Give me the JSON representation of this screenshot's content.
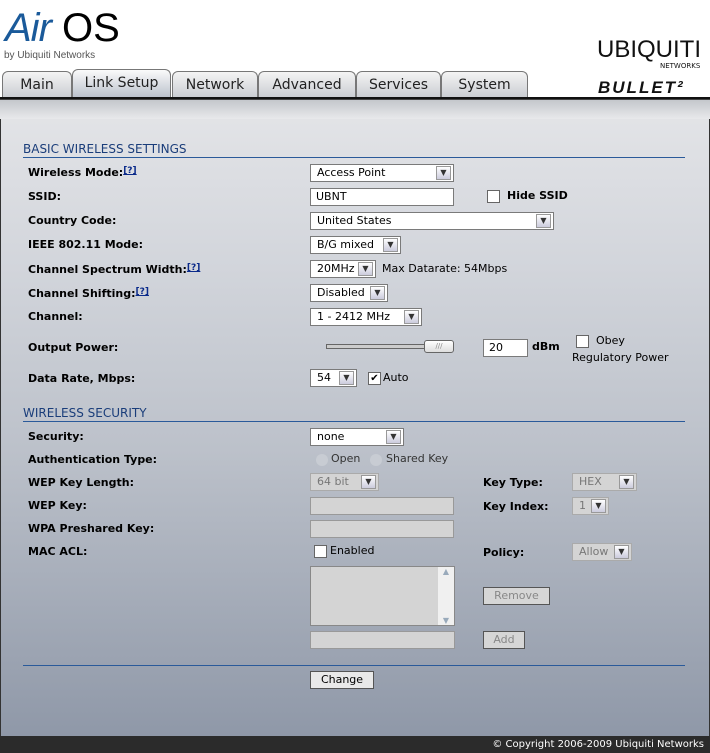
{
  "header": {
    "logo_left": "AirOS",
    "logo_by": "by Ubiquiti Networks",
    "logo_right": "UBIQUITI",
    "logo_right_sub": "NETWORKS",
    "product": "BULLET2"
  },
  "tabs": [
    {
      "label": "Main"
    },
    {
      "label": "Link Setup",
      "active": true
    },
    {
      "label": "Network"
    },
    {
      "label": "Advanced"
    },
    {
      "label": "Services"
    },
    {
      "label": "System"
    }
  ],
  "basic": {
    "title": "BASIC WIRELESS SETTINGS",
    "wireless_mode": {
      "label": "Wireless Mode:",
      "help": "[?]",
      "value": "Access Point"
    },
    "ssid": {
      "label": "SSID:",
      "value": "UBNT",
      "hide_label": "Hide SSID",
      "hide_checked": false
    },
    "country": {
      "label": "Country Code:",
      "value": "United States"
    },
    "ieee": {
      "label": "IEEE 802.11 Mode:",
      "value": "B/G mixed"
    },
    "spectrum": {
      "label": "Channel Spectrum Width:",
      "help": "[?]",
      "value": "20MHz",
      "max_datarate": "Max Datarate: 54Mbps"
    },
    "shifting": {
      "label": "Channel Shifting:",
      "help": "[?]",
      "value": "Disabled"
    },
    "channel": {
      "label": "Channel:",
      "value": "1 - 2412 MHz"
    },
    "power": {
      "label": "Output Power:",
      "value": "20",
      "unit": "dBm",
      "slider_percent": 100,
      "obey_label": "Obey",
      "obey_label2": "Regulatory Power",
      "obey_checked": false
    },
    "datarate": {
      "label": "Data Rate, Mbps:",
      "value": "54",
      "auto_label": "Auto",
      "auto_checked": true
    }
  },
  "security": {
    "title": "WIRELESS SECURITY",
    "security": {
      "label": "Security:",
      "value": "none"
    },
    "auth": {
      "label": "Authentication Type:",
      "open": "Open",
      "shared": "Shared Key"
    },
    "wep_len": {
      "label": "WEP Key Length:",
      "value": "64 bit"
    },
    "key_type": {
      "label": "Key Type:",
      "value": "HEX"
    },
    "wep_key": {
      "label": "WEP Key:",
      "value": ""
    },
    "key_index": {
      "label": "Key Index:",
      "value": "1"
    },
    "wpa": {
      "label": "WPA Preshared Key:",
      "value": ""
    },
    "mac_acl": {
      "label": "MAC ACL:",
      "enabled_label": "Enabled",
      "enabled": false
    },
    "policy": {
      "label": "Policy:",
      "value": "Allow"
    },
    "remove": "Remove",
    "add": "Add"
  },
  "change": "Change",
  "footer": "© Copyright 2006-2009 Ubiquiti Networks"
}
